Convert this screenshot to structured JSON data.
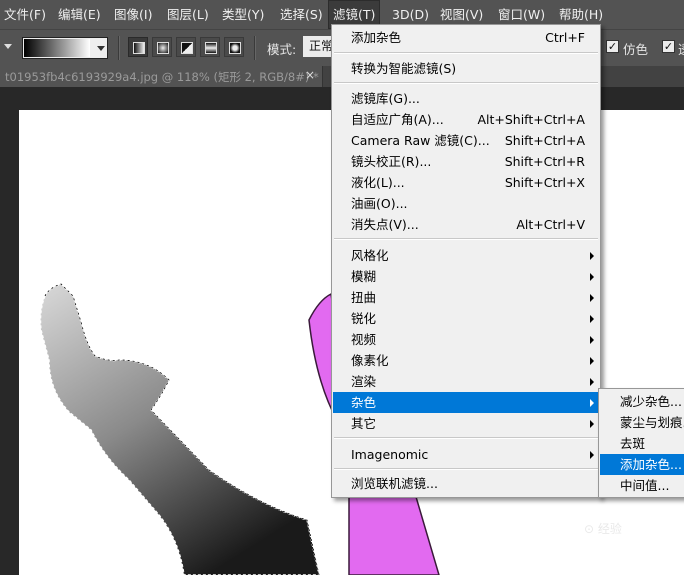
{
  "menubar": {
    "items": [
      {
        "label": "文件(F)"
      },
      {
        "label": "编辑(E)"
      },
      {
        "label": "图像(I)"
      },
      {
        "label": "图层(L)"
      },
      {
        "label": "类型(Y)"
      },
      {
        "label": "选择(S)"
      },
      {
        "label": "滤镜(T)",
        "active": true
      },
      {
        "label": "3D(D)"
      },
      {
        "label": "视图(V)"
      },
      {
        "label": "窗口(W)"
      },
      {
        "label": "帮助(H)"
      }
    ]
  },
  "options": {
    "mode_label": "模式:",
    "mode_value": "正常",
    "dither_label": "仿色",
    "checkbox_checked": "✓",
    "extra_label": "透"
  },
  "document": {
    "tab_title": "t01953fb4c6193929a4.jpg @ 118% (矩形 2, RGB/8#) *",
    "close_glyph": "×"
  },
  "filter_menu": {
    "items": [
      {
        "label": "添加杂色",
        "shortcut": "Ctrl+F"
      },
      {
        "label": "转换为智能滤镜(S)"
      },
      {
        "label": "滤镜库(G)..."
      },
      {
        "label": "自适应广角(A)...",
        "shortcut": "Alt+Shift+Ctrl+A"
      },
      {
        "label": "Camera Raw 滤镜(C)...",
        "shortcut": "Shift+Ctrl+A"
      },
      {
        "label": "镜头校正(R)...",
        "shortcut": "Shift+Ctrl+R"
      },
      {
        "label": "液化(L)...",
        "shortcut": "Shift+Ctrl+X"
      },
      {
        "label": "油画(O)..."
      },
      {
        "label": "消失点(V)...",
        "shortcut": "Alt+Ctrl+V"
      },
      {
        "label": "风格化",
        "submenu": true
      },
      {
        "label": "模糊",
        "submenu": true
      },
      {
        "label": "扭曲",
        "submenu": true
      },
      {
        "label": "锐化",
        "submenu": true
      },
      {
        "label": "视频",
        "submenu": true
      },
      {
        "label": "像素化",
        "submenu": true
      },
      {
        "label": "渲染",
        "submenu": true
      },
      {
        "label": "杂色",
        "submenu": true,
        "highlighted": true
      },
      {
        "label": "其它",
        "submenu": true
      },
      {
        "label": "Imagenomic",
        "submenu": true
      },
      {
        "label": "浏览联机滤镜..."
      }
    ]
  },
  "noise_submenu": {
    "items": [
      {
        "label": "减少杂色..."
      },
      {
        "label": "蒙尘与划痕..."
      },
      {
        "label": "去斑"
      },
      {
        "label": "添加杂色...",
        "highlighted": true
      },
      {
        "label": "中间值..."
      }
    ]
  },
  "watermark": "⊙ 经验"
}
